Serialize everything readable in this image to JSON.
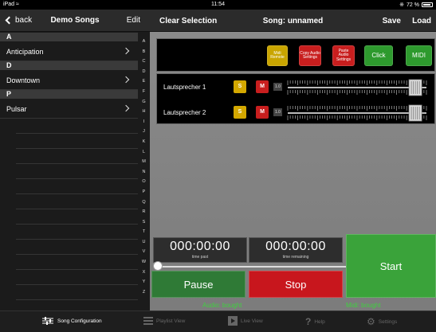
{
  "status": {
    "device": "iPad",
    "time": "11:54",
    "battery": "72 %",
    "battery_level": 0.72
  },
  "sidebar": {
    "back_label": "back",
    "title": "Demo Songs",
    "edit_label": "Edit",
    "sections": [
      {
        "header": "A",
        "items": [
          "Anticipation"
        ]
      },
      {
        "header": "D",
        "items": [
          "Downtown"
        ]
      },
      {
        "header": "P",
        "items": [
          "Pulsar"
        ]
      }
    ],
    "index_letters": [
      "A",
      "B",
      "C",
      "D",
      "E",
      "F",
      "G",
      "H",
      "I",
      "J",
      "K",
      "L",
      "M",
      "N",
      "O",
      "P",
      "Q",
      "R",
      "S",
      "T",
      "U",
      "V",
      "W",
      "X",
      "Y",
      "Z"
    ]
  },
  "header": {
    "clear_label": "Clear Selection",
    "song_label": "Song: unnamed",
    "save_label": "Save",
    "load_label": "Load"
  },
  "toolbar": {
    "midi_remote": "Midi Remote",
    "copy_audio": "Copy Audio Settings",
    "paste_audio": "Paste Audio Settings",
    "click": "Click",
    "midi": "MIDI"
  },
  "channels": [
    {
      "name": "Lautsprecher 1",
      "solo": "S",
      "mute": "M",
      "volume": "1.0",
      "level": 0.92
    },
    {
      "name": "Lautsprecher 2",
      "solo": "S",
      "mute": "M",
      "volume": "1.0",
      "level": 0.92
    }
  ],
  "transport": {
    "time_past": "000:00:00",
    "time_past_label": "time past",
    "time_remaining": "000:00:00",
    "time_remaining_label": "time remaining",
    "position": 0,
    "pause_label": "Pause",
    "stop_label": "Stop",
    "start_label": "Start",
    "audio_license": "Audio: bought",
    "midi_license": "Midi: bought"
  },
  "tabs": [
    {
      "label": "Song Configuration",
      "icon": "sliders-icon",
      "active": true
    },
    {
      "label": "Playlist View",
      "icon": "list-icon",
      "active": false
    },
    {
      "label": "Live View",
      "icon": "play-icon",
      "active": false
    },
    {
      "label": "Help",
      "icon": "question-icon",
      "active": false
    },
    {
      "label": "Settings",
      "icon": "gear-icon",
      "active": false
    }
  ],
  "colors": {
    "accent_green": "#3aa33a",
    "stop_red": "#c8161d",
    "solo_yellow": "#d4a800",
    "license_green": "#3fd03f"
  }
}
